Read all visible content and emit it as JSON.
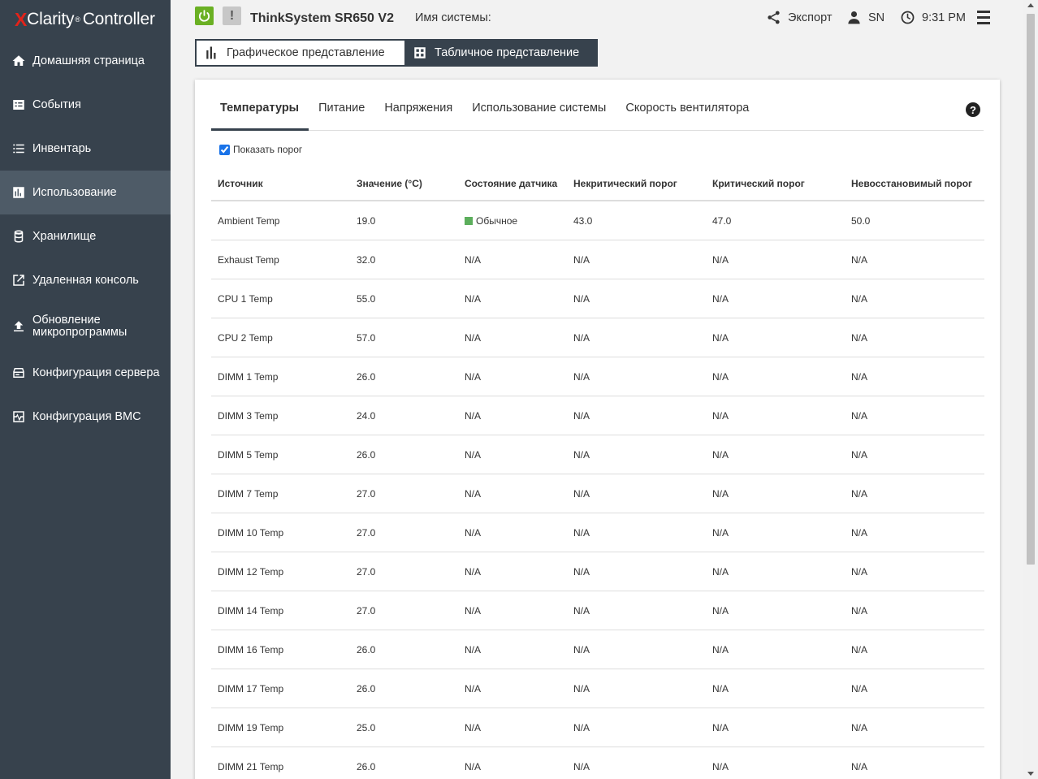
{
  "logo": {
    "x": "X",
    "clarity": "Clarity",
    "tm": "®",
    "controller": "Controller"
  },
  "sidebar": {
    "items": [
      {
        "label": "Домашняя страница",
        "icon": "home-icon"
      },
      {
        "label": "События",
        "icon": "events-icon"
      },
      {
        "label": "Инвентарь",
        "icon": "list-icon"
      },
      {
        "label": "Использование",
        "icon": "bar-chart-icon",
        "active": true
      },
      {
        "label": "Хранилище",
        "icon": "database-icon"
      },
      {
        "label": "Удаленная консоль",
        "icon": "external-link-icon"
      },
      {
        "label": "Обновление микропрограммы",
        "icon": "upload-icon"
      },
      {
        "label": "Конфигурация сервера",
        "icon": "server-icon"
      },
      {
        "label": "Конфигурация BMC",
        "icon": "pulse-icon"
      }
    ]
  },
  "header": {
    "model": "ThinkSystem SR650 V2",
    "system_name_label": "Имя системы:",
    "export": "Экспорт",
    "user": "SN",
    "time": "9:31 PM",
    "alert_glyph": "!"
  },
  "view_toggle": {
    "graphic": "Графическое представление",
    "table": "Табличное представление"
  },
  "tabs": [
    "Температуры",
    "Питание",
    "Напряжения",
    "Использование системы",
    "Скорость вентилятора"
  ],
  "help_glyph": "?",
  "show_threshold_label": "Показать порог",
  "table": {
    "columns": [
      "Источник",
      "Значение (°C)",
      "Состояние датчика",
      "Некритический порог",
      "Критический порог",
      "Невосстановимый порог"
    ],
    "rows": [
      [
        "Ambient Temp",
        "19.0",
        "Обычное",
        "43.0",
        "47.0",
        "50.0"
      ],
      [
        "Exhaust Temp",
        "32.0",
        "N/A",
        "N/A",
        "N/A",
        "N/A"
      ],
      [
        "CPU 1 Temp",
        "55.0",
        "N/A",
        "N/A",
        "N/A",
        "N/A"
      ],
      [
        "CPU 2 Temp",
        "57.0",
        "N/A",
        "N/A",
        "N/A",
        "N/A"
      ],
      [
        "DIMM 1 Temp",
        "26.0",
        "N/A",
        "N/A",
        "N/A",
        "N/A"
      ],
      [
        "DIMM 3 Temp",
        "24.0",
        "N/A",
        "N/A",
        "N/A",
        "N/A"
      ],
      [
        "DIMM 5 Temp",
        "26.0",
        "N/A",
        "N/A",
        "N/A",
        "N/A"
      ],
      [
        "DIMM 7 Temp",
        "27.0",
        "N/A",
        "N/A",
        "N/A",
        "N/A"
      ],
      [
        "DIMM 10 Temp",
        "27.0",
        "N/A",
        "N/A",
        "N/A",
        "N/A"
      ],
      [
        "DIMM 12 Temp",
        "27.0",
        "N/A",
        "N/A",
        "N/A",
        "N/A"
      ],
      [
        "DIMM 14 Temp",
        "27.0",
        "N/A",
        "N/A",
        "N/A",
        "N/A"
      ],
      [
        "DIMM 16 Temp",
        "26.0",
        "N/A",
        "N/A",
        "N/A",
        "N/A"
      ],
      [
        "DIMM 17 Temp",
        "26.0",
        "N/A",
        "N/A",
        "N/A",
        "N/A"
      ],
      [
        "DIMM 19 Temp",
        "25.0",
        "N/A",
        "N/A",
        "N/A",
        "N/A"
      ],
      [
        "DIMM 21 Temp",
        "26.0",
        "N/A",
        "N/A",
        "N/A",
        "N/A"
      ]
    ]
  },
  "colors": {
    "sidebar": "#37424d",
    "sidebar_active": "#4e5b67",
    "power": "#6ab023",
    "logo_x": "#e2231a",
    "status_normal": "#5cae5c"
  }
}
